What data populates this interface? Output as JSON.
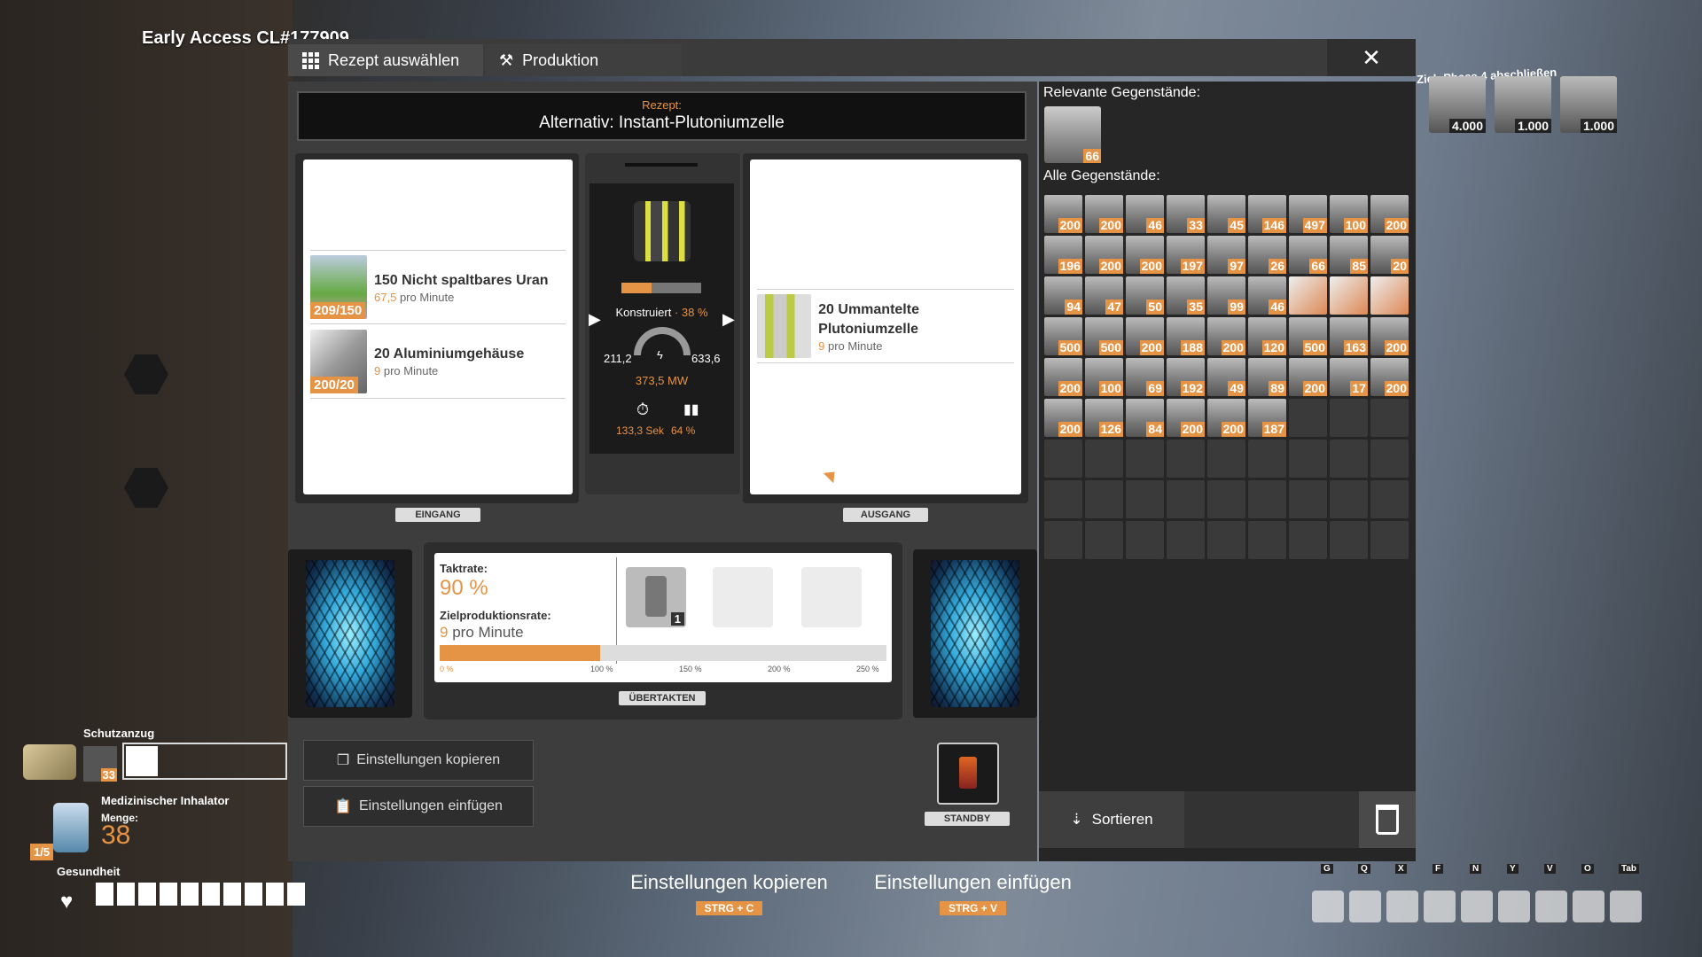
{
  "build_label": "Early Access CL#177909",
  "tabs": [
    {
      "label": "Rezept auswählen"
    },
    {
      "label": "Produktion"
    }
  ],
  "close_label": "✕",
  "recipe": {
    "label": "Rezept:",
    "name": "Alternativ: Instant-Plutoniumzelle"
  },
  "inputs": [
    {
      "title": "150 Nicht spaltbares Uran",
      "count": "209/150",
      "rate": "67,5",
      "rate_unit": "pro Minute"
    },
    {
      "title": "20 Aluminiumgehäuse",
      "count": "200/20",
      "rate": "9",
      "rate_unit": "pro Minute"
    }
  ],
  "input_tag": "EINGANG",
  "output": {
    "title": "20 Ummantelte Plutoniumzelle",
    "rate": "9",
    "rate_unit": "pro Minute"
  },
  "output_tag": "AUSGANG",
  "machine": {
    "status": "Konstruiert",
    "progress": "38 %",
    "progress_value": 0.38,
    "power_min": "211,2",
    "power_max": "633,6",
    "power_current": "373,5 MW",
    "cycle_time": "133,3 Sek",
    "productivity": "64 %"
  },
  "overclock": {
    "clock_label": "Taktrate:",
    "clock_value": "90 %",
    "target_label": "Zielproduktionsrate:",
    "target_rate": "9",
    "target_unit": "pro Minute",
    "scale": [
      "0 %",
      "100 %",
      "150 %",
      "200 %",
      "250 %"
    ],
    "shard_count": "1",
    "tag": "ÜBERTAKTEN",
    "fill": 0.9
  },
  "buttons": {
    "copy": "Einstellungen kopieren",
    "paste": "Einstellungen einfügen",
    "standby": "STANDBY"
  },
  "inventory": {
    "relevant_label": "Relevante Gegenstände:",
    "relevant_count": "66",
    "all_label": "Alle Gegenstände:",
    "counts": [
      "200",
      "200",
      "46",
      "33",
      "45",
      "146",
      "497",
      "100",
      "200",
      "196",
      "200",
      "200",
      "197",
      "97",
      "26",
      "66",
      "85",
      "20",
      "94",
      "47",
      "50",
      "35",
      "99",
      "46",
      "",
      "",
      "",
      "500",
      "500",
      "200",
      "188",
      "200",
      "120",
      "500",
      "163",
      "200",
      "200",
      "100",
      "69",
      "192",
      "49",
      "89",
      "200",
      "17",
      "200",
      "200",
      "126",
      "84",
      "200",
      "200",
      "187"
    ],
    "empty_slots": 30,
    "sort_label": "Sortieren"
  },
  "goal": {
    "label": "Ziel: Phase 4 abschließen",
    "items": [
      "4.000",
      "1.000",
      "1.000"
    ]
  },
  "hints": [
    {
      "label": "Einstellungen kopieren",
      "key": "STRG + C"
    },
    {
      "label": "Einstellungen einfügen",
      "key": "STRG + V"
    }
  ],
  "hud": {
    "suit_label": "Schutzanzug",
    "suit_count": "33",
    "inhaler_label": "Medizinischer Inhalator",
    "amount_label": "Menge:",
    "amount": "38",
    "inhaler_slots": "1/5",
    "health_label": "Gesundheit"
  },
  "hotbar_keys": [
    "G",
    "Q",
    "X",
    "F",
    "N",
    "Y",
    "V",
    "O",
    "Tab"
  ],
  "colors": {
    "accent": "#e59345",
    "panel": "#3d3d3d"
  }
}
